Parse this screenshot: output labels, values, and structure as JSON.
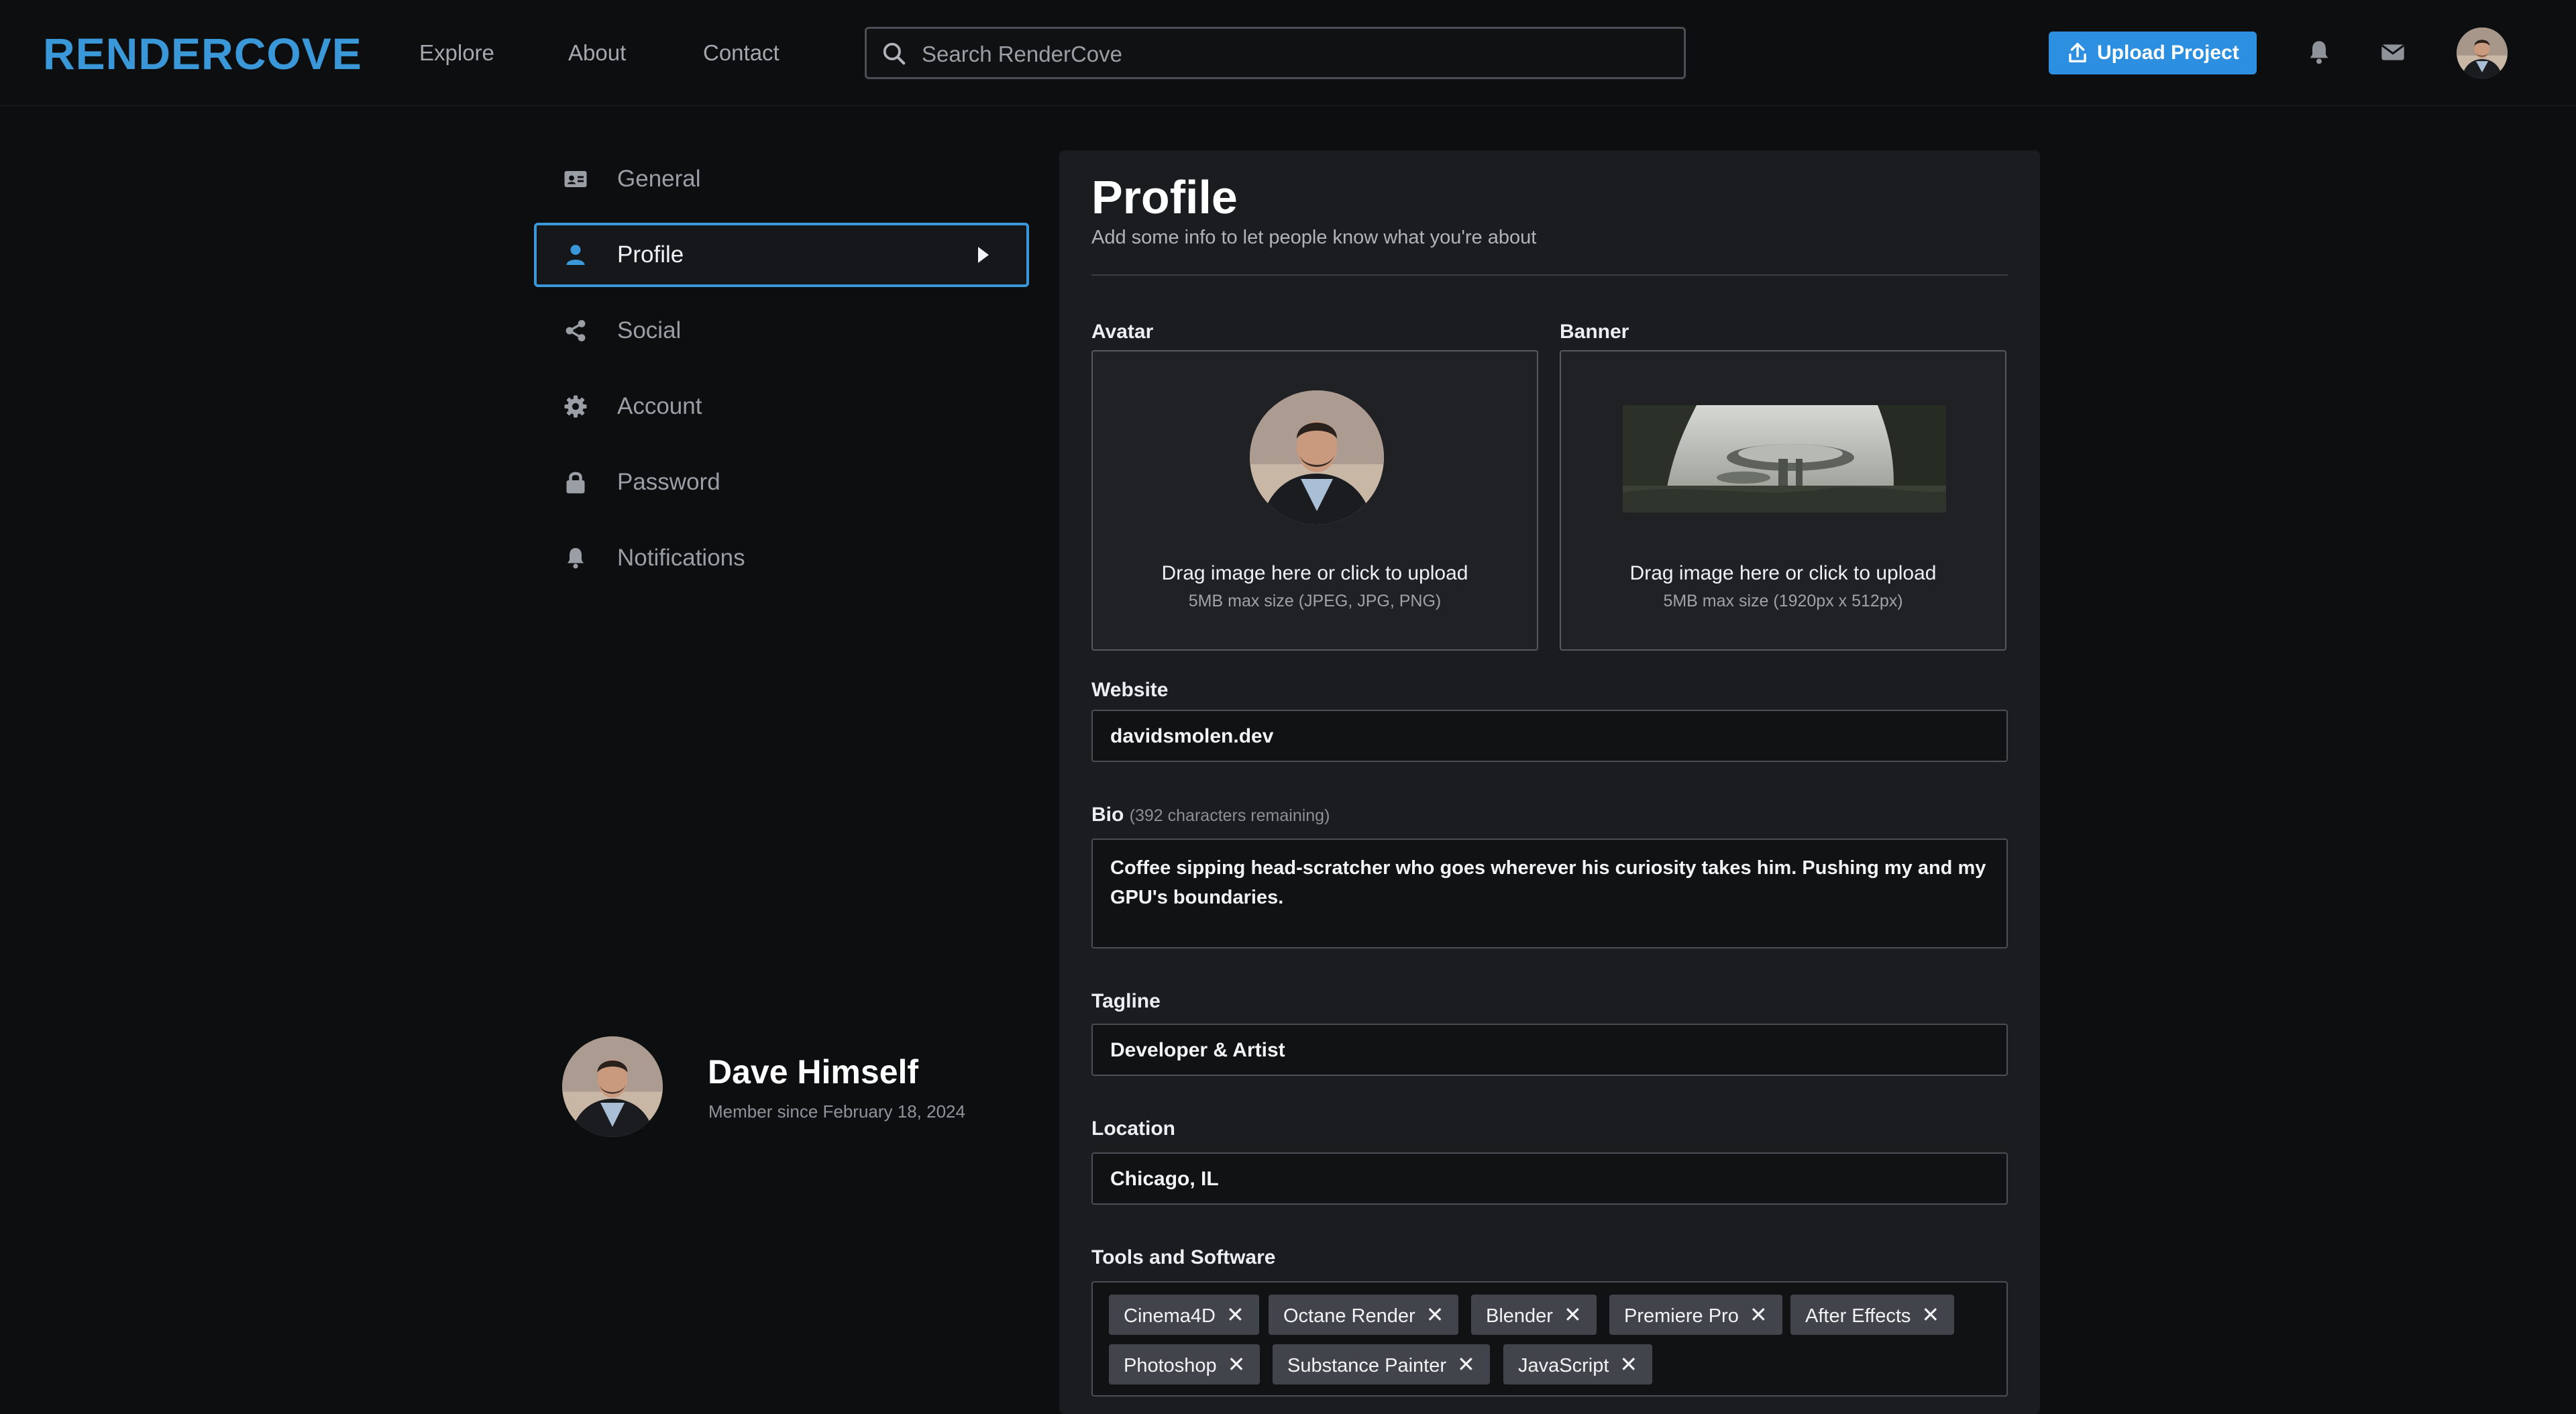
{
  "header": {
    "logo": "RENDERCOVE",
    "nav": [
      "Explore",
      "About",
      "Contact"
    ],
    "search_placeholder": "Search RenderCove",
    "upload_label": "Upload Project"
  },
  "sidebar": {
    "items": [
      {
        "label": "General",
        "icon": "id-card-icon"
      },
      {
        "label": "Profile",
        "icon": "user-icon"
      },
      {
        "label": "Social",
        "icon": "share-icon"
      },
      {
        "label": "Account",
        "icon": "gear-icon"
      },
      {
        "label": "Password",
        "icon": "lock-icon"
      },
      {
        "label": "Notifications",
        "icon": "bell-icon"
      }
    ],
    "active_index": 1,
    "user_name": "Dave Himself",
    "member_since": "Member since February 18, 2024"
  },
  "profile": {
    "title": "Profile",
    "subtitle": "Add some info to let people know what you're about",
    "avatar_label": "Avatar",
    "banner_label": "Banner",
    "drop_text": "Drag image here or click to upload",
    "avatar_hint": "5MB max size (JPEG, JPG, PNG)",
    "banner_hint": "5MB max size (1920px x 512px)",
    "website_label": "Website",
    "website_value": "davidsmolen.dev",
    "bio_label": "Bio",
    "bio_hint": "(392 characters remaining)",
    "bio_value": "Coffee sipping head-scratcher who goes wherever his curiosity takes him. Pushing my and my GPU's boundaries.",
    "tagline_label": "Tagline",
    "tagline_value": "Developer & Artist",
    "location_label": "Location",
    "location_value": "Chicago, IL",
    "tools_label": "Tools and Software",
    "tools": [
      "Cinema4D",
      "Octane Render",
      "Blender",
      "Premiere Pro",
      "After Effects",
      "Photoshop",
      "Substance Painter",
      "JavaScript"
    ],
    "tag_remove_glyph": "✕"
  },
  "colors": {
    "accent": "#3a98d8",
    "button": "#2c8fe0",
    "background": "#0d0e10",
    "panel": "#1a1c1f"
  }
}
